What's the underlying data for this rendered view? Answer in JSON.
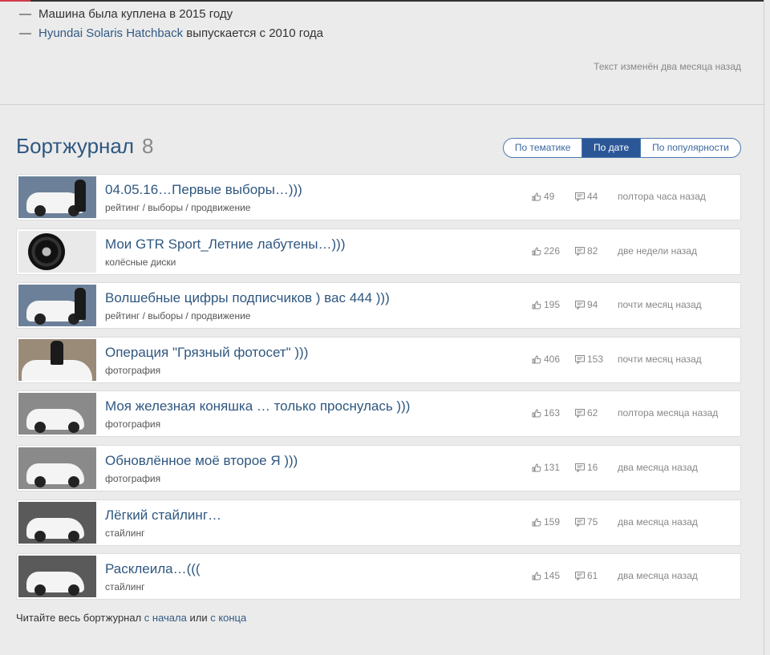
{
  "facts": [
    {
      "dash": "—",
      "text": "Машина была куплена в 2015 году"
    },
    {
      "dash": "—",
      "link": "Hyundai Solaris Hatchback",
      "text": " выпускается с 2010 года"
    }
  ],
  "edited_note": "Текст изменён два месяца назад",
  "logbook": {
    "title": "Бортжурнал",
    "count": "8",
    "sort_tabs": [
      {
        "label": "По тематике",
        "active": false
      },
      {
        "label": "По дате",
        "active": true
      },
      {
        "label": "По популярности",
        "active": false
      }
    ],
    "posts": [
      {
        "title": "04.05.16…Первые выборы…)))",
        "tags": "рейтинг / выборы / продвижение",
        "likes": "49",
        "comments": "44",
        "time": "полтора часа назад",
        "thumb": "car-person"
      },
      {
        "title": "Мои GTR Sport_Летние лабутены…)))",
        "tags": "колёсные диски",
        "likes": "226",
        "comments": "82",
        "time": "две недели назад",
        "thumb": "rim"
      },
      {
        "title": "Волшебные цифры подписчиков ) вас 444 )))",
        "tags": "рейтинг / выборы / продвижение",
        "likes": "195",
        "comments": "94",
        "time": "почти месяц назад",
        "thumb": "car-person"
      },
      {
        "title": "Операция \"Грязный фотосет\" )))",
        "tags": "фотография",
        "likes": "406",
        "comments": "153",
        "time": "почти месяц назад",
        "thumb": "person-hood"
      },
      {
        "title": "Моя железная коняшка … только проснулась )))",
        "tags": "фотография",
        "likes": "163",
        "comments": "62",
        "time": "полтора месяца назад",
        "thumb": "car"
      },
      {
        "title": "Обновлённое моё второе Я )))",
        "tags": "фотография",
        "likes": "131",
        "comments": "16",
        "time": "два месяца назад",
        "thumb": "car"
      },
      {
        "title": "Лёгкий стайлинг…",
        "tags": "стайлинг",
        "likes": "159",
        "comments": "75",
        "time": "два месяца назад",
        "thumb": "car-dark"
      },
      {
        "title": "Расклеила…(((",
        "tags": "стайлинг",
        "likes": "145",
        "comments": "61",
        "time": "два месяца назад",
        "thumb": "car-dark"
      }
    ]
  },
  "footer": {
    "prefix": "Читайте весь бортжурнал ",
    "from_start": "с начала",
    "middle": " или ",
    "from_end": "с конца"
  },
  "colors": {
    "link": "#2f5780",
    "active_tab": "#2b5797",
    "accent": "#d03a4a"
  },
  "icons": {
    "like": "thumbs-up-icon",
    "comment": "comment-icon"
  }
}
